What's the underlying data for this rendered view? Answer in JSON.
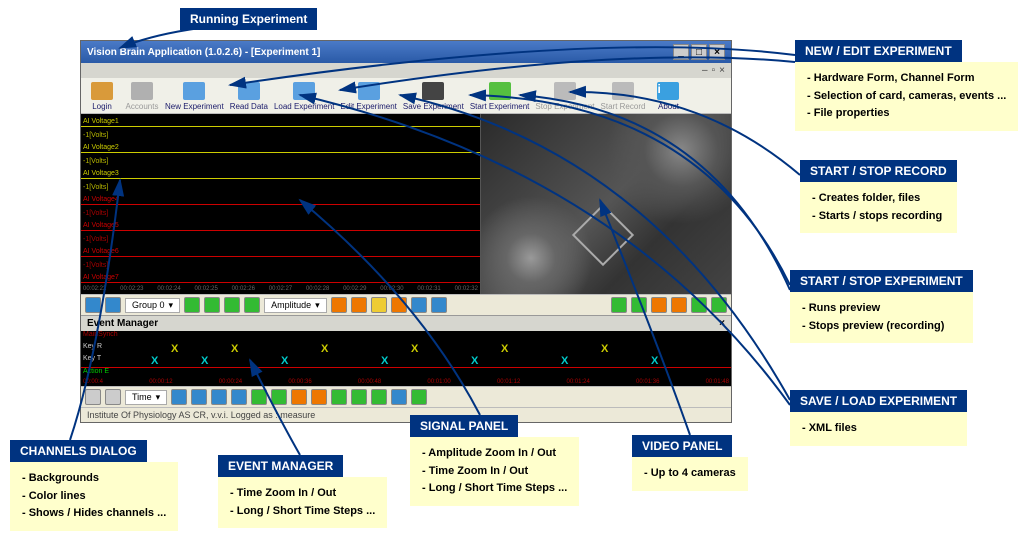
{
  "top_label": "Running Experiment",
  "window": {
    "title": "Vision Brain Application  (1.0.2.6) - [Experiment 1]",
    "status": "Institute Of Physiology AS CR, v.v.i.   Logged as : measure"
  },
  "toolbar": {
    "login": "Login",
    "accounts": "Accounts",
    "newexp": "New Experiment",
    "read": "Read Data",
    "loadexp": "Load Experiment",
    "edit": "Edit Experiment",
    "saveexp": "Save Experiment",
    "start": "Start Experiment",
    "stop": "Stop Experiment",
    "rec": "Start Record",
    "about": "About"
  },
  "signal": {
    "group": "Group 0",
    "amp": "Amplitude"
  },
  "eventmgr": {
    "title": "Event Manager",
    "time": "Time",
    "row1": "MainSynch",
    "row2": "Key R",
    "row3": "Key T",
    "row4": "Action E"
  },
  "callouts": {
    "newedit": {
      "header": "NEW / EDIT EXPERIMENT",
      "l1": "- Hardware Form, Channel Form",
      "l2": "- Selection of card, cameras, events ...",
      "l3": "- File properties"
    },
    "startstoprec": {
      "header": "START / STOP RECORD",
      "l1": "- Creates folder, files",
      "l2": "- Starts / stops recording"
    },
    "startstopexp": {
      "header": "START / STOP EXPERIMENT",
      "l1": "- Runs preview",
      "l2": "- Stops preview (recording)"
    },
    "saveload": {
      "header": "SAVE / LOAD EXPERIMENT",
      "l1": "- XML files"
    },
    "video": {
      "header": "VIDEO PANEL",
      "l1": "- Up to 4 cameras"
    },
    "signalp": {
      "header": "SIGNAL PANEL",
      "l1": "- Amplitude Zoom In / Out",
      "l2": "- Time Zoom In / Out",
      "l3": "- Long / Short Time Steps ..."
    },
    "eventm": {
      "header": "EVENT MANAGER",
      "l1": "- Time Zoom In / Out",
      "l2": "- Long / Short Time Steps ..."
    },
    "channels": {
      "header": "CHANNELS DIALOG",
      "l1": "- Backgrounds",
      "l2": "- Color lines",
      "l3": "- Shows / Hides channels ..."
    }
  }
}
